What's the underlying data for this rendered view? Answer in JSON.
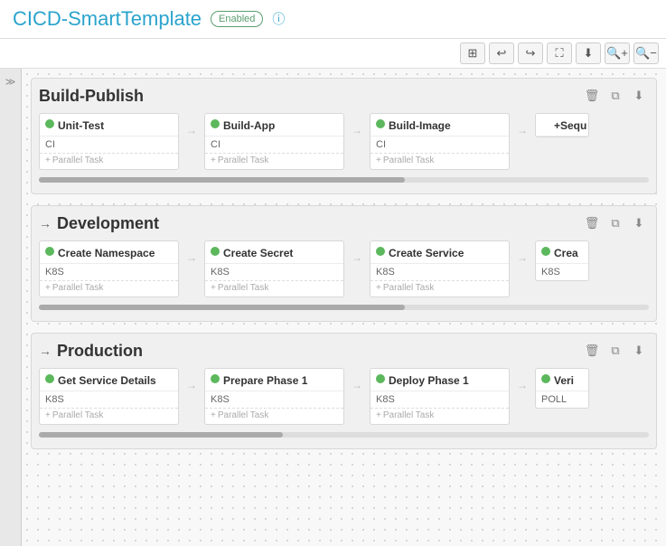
{
  "header": {
    "title": "CICD-SmartTemplate",
    "badge": "Enabled",
    "info_icon": "ⓘ"
  },
  "toolbar": {
    "grid_icon": "⊞",
    "undo_icon": "↩",
    "redo_icon": "↪",
    "fit_icon": "⛶",
    "download_icon": "⬇",
    "zoom_in_icon": "+",
    "zoom_out_icon": "−",
    "sidebar_toggle": "≫"
  },
  "phases": [
    {
      "id": "build-publish",
      "title": "Build-Publish",
      "has_arrow": false,
      "tasks": [
        {
          "id": "unit-test",
          "name": "Unit-Test",
          "type": "CI",
          "status": "ok"
        },
        {
          "id": "build-app",
          "name": "Build-App",
          "type": "CI",
          "status": "ok"
        },
        {
          "id": "build-image",
          "name": "Build-Image",
          "type": "CI",
          "status": "ok"
        }
      ],
      "partial_label": "Sequ",
      "parallel_label": "+ Parallel Task"
    },
    {
      "id": "development",
      "title": "Development",
      "has_arrow": true,
      "tasks": [
        {
          "id": "create-namespace",
          "name": "Create Namespace",
          "type": "K8S",
          "status": "ok"
        },
        {
          "id": "create-secret",
          "name": "Create Secret",
          "type": "K8S",
          "status": "ok"
        },
        {
          "id": "create-service",
          "name": "Create Service",
          "type": "K8S",
          "status": "ok"
        }
      ],
      "partial_label": "Crea",
      "partial_type": "K8S",
      "parallel_label": "+ Parallel Task"
    },
    {
      "id": "production",
      "title": "Production",
      "has_arrow": true,
      "tasks": [
        {
          "id": "get-service-details",
          "name": "Get Service Details",
          "type": "K8S",
          "status": "ok"
        },
        {
          "id": "prepare-phase-1",
          "name": "Prepare Phase 1",
          "type": "K8S",
          "status": "ok"
        },
        {
          "id": "deploy-phase-1",
          "name": "Deploy Phase 1",
          "type": "K8S",
          "status": "ok"
        }
      ],
      "partial_label": "Veri",
      "partial_type": "POLL",
      "parallel_label": "+ Parallel Task"
    }
  ],
  "action_icons": {
    "trash": "🗑",
    "copy": "⧉",
    "export": "⬇"
  }
}
